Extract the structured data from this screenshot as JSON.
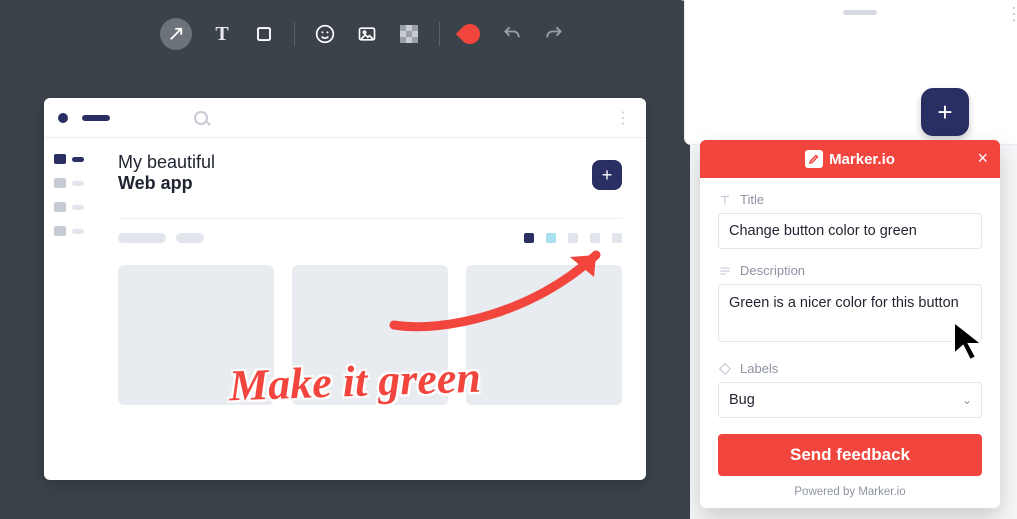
{
  "toolbar": {
    "tools": [
      "arrow",
      "text",
      "rectangle",
      "emoji",
      "image",
      "blur",
      "color",
      "undo",
      "redo"
    ]
  },
  "mock_app": {
    "title_line1": "My beautiful",
    "title_line2": "Web app",
    "plus_label": "+"
  },
  "annotation": {
    "text": "Make it green"
  },
  "fab": {
    "label": "+"
  },
  "panel": {
    "brand": "Marker.io",
    "fields": {
      "title": {
        "label": "Title",
        "value": "Change button color to green"
      },
      "description": {
        "label": "Description",
        "value": "Green is a nicer color for this button"
      },
      "labels": {
        "label": "Labels",
        "value": "Bug"
      }
    },
    "submit": "Send feedback",
    "footer": "Powered by Marker.io"
  },
  "colors": {
    "accent_red": "#f2453d",
    "accent_navy": "#2a2f63",
    "editor_bg": "#3b424a"
  }
}
